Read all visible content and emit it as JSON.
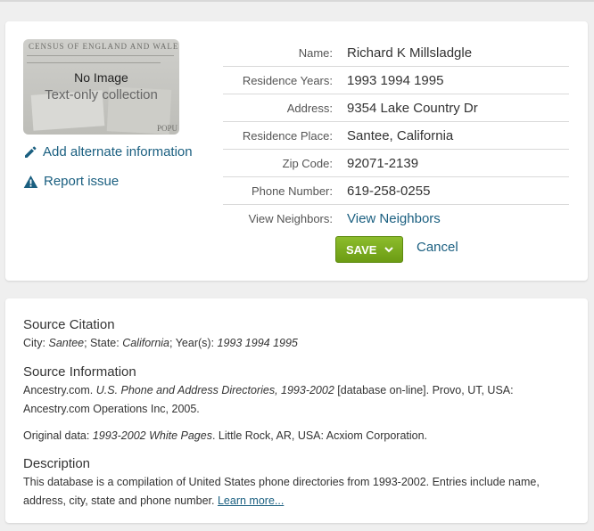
{
  "thumbnail": {
    "census_text": "CENSUS OF ENGLAND AND WALES,",
    "popu_text": "POPU",
    "no_image": "No Image",
    "collection_type": "Text-only collection"
  },
  "sidebar": {
    "alternate_info": "Add alternate information",
    "report_issue": "Report issue"
  },
  "record": {
    "name_label": "Name:",
    "name": "Richard K Millsladgle",
    "years_label": "Residence Years:",
    "years": "1993 1994 1995",
    "address_label": "Address:",
    "address": "9354 Lake Country Dr",
    "place_label": "Residence Place:",
    "place": "Santee, California",
    "zip_label": "Zip Code:",
    "zip": "92071-2139",
    "phone_label": "Phone Number:",
    "phone": "619-258-0255",
    "neighbors_label": "View Neighbors:",
    "neighbors": "View Neighbors"
  },
  "actions": {
    "save": "SAVE",
    "cancel": "Cancel"
  },
  "source": {
    "citation_heading": "Source Citation",
    "city_label": "City: ",
    "city": "Santee",
    "state_label": "; State: ",
    "state": "California",
    "years_label": "; Year(s): ",
    "years": "1993 1994 1995",
    "info_heading": "Source Information",
    "info_prefix": "Ancestry.com. ",
    "info_title": "U.S. Phone and Address Directories, 1993-2002",
    "info_suffix": " [database on-line]. Provo, UT, USA: Ancestry.com Operations Inc, 2005.",
    "original_prefix": "Original data: ",
    "original_title": "1993-2002 White Pages",
    "original_suffix": ". Little Rock, AR, USA: Acxiom Corporation.",
    "description_heading": "Description",
    "description": "This database is a compilation of United States phone directories from 1993-2002. Entries include name, address, city, state and phone number. ",
    "learn_more": "Learn more..."
  },
  "colors": {
    "link": "#1a5f80",
    "save_green": "#7aab1e",
    "background": "#efefef"
  }
}
